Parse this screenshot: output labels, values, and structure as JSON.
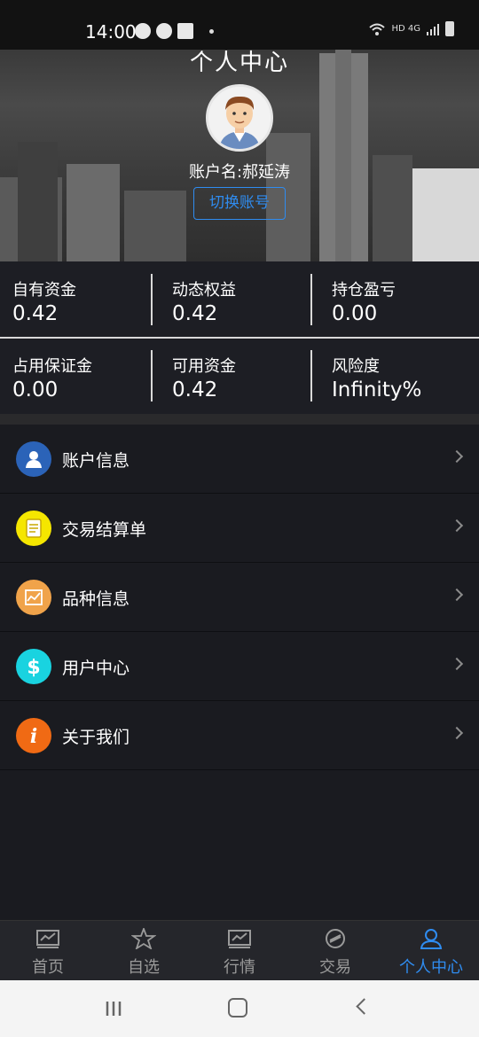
{
  "status_bar": {
    "time": "14:00",
    "network": "HD 4G"
  },
  "header": {
    "title": "个人中心",
    "account_name": "账户名:郝延涛",
    "switch_button": "切换账号"
  },
  "stats": {
    "row1": [
      {
        "label": "自有资金",
        "value": "0.42"
      },
      {
        "label": "动态权益",
        "value": "0.42"
      },
      {
        "label": "持仓盈亏",
        "value": "0.00"
      }
    ],
    "row2": [
      {
        "label": "占用保证金",
        "value": "0.00"
      },
      {
        "label": "可用资金",
        "value": "0.42"
      },
      {
        "label": "风险度",
        "value": "Infinity%"
      }
    ]
  },
  "menu": {
    "items": [
      {
        "label": "账户信息",
        "icon": "user-icon",
        "color": "#2b63b8"
      },
      {
        "label": "交易结算单",
        "icon": "document-icon",
        "color": "#f5e600"
      },
      {
        "label": "品种信息",
        "icon": "chart-icon",
        "color": "#f0a34a"
      },
      {
        "label": "用户中心",
        "icon": "dollar-icon",
        "color": "#19d3e0"
      },
      {
        "label": "关于我们",
        "icon": "info-icon",
        "color": "#f06a14"
      }
    ]
  },
  "tabbar": {
    "tabs": [
      {
        "label": "首页",
        "icon": "home-chart-icon"
      },
      {
        "label": "自选",
        "icon": "star-icon"
      },
      {
        "label": "行情",
        "icon": "market-icon"
      },
      {
        "label": "交易",
        "icon": "trade-icon"
      },
      {
        "label": "个人中心",
        "icon": "person-icon"
      }
    ],
    "active_color": "#2f8cf0"
  }
}
